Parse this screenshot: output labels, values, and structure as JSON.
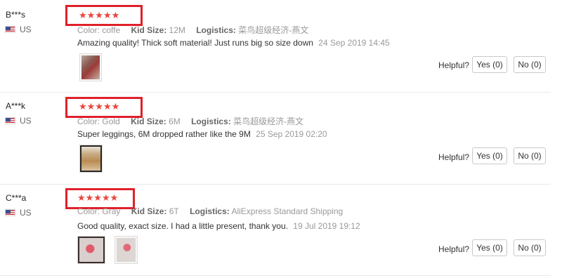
{
  "reviews": [
    {
      "name": "B***s",
      "country": "US",
      "stars": "★★★★★",
      "color_label": "Color:",
      "color_value": "coffe",
      "size_label": "Kid Size:",
      "size_value": "12M",
      "logistics_label": "Logistics:",
      "logistics_value": "菜鸟超级经济-燕文",
      "text": "Amazing quality! Thick soft material! Just runs big so size down",
      "date": "24 Sep 2019 14:45",
      "helpful_label": "Helpful?",
      "yes_label": "Yes (0)",
      "no_label": "No (0)"
    },
    {
      "name": "A***k",
      "country": "US",
      "stars": "★★★★★",
      "color_label": "Color:",
      "color_value": "Gold",
      "size_label": "Kid Size:",
      "size_value": "6M",
      "logistics_label": "Logistics:",
      "logistics_value": "菜鸟超级经济-燕文",
      "text": "Super leggings, 6M dropped rather like the 9M",
      "date": "25 Sep 2019 02:20",
      "helpful_label": "Helpful?",
      "yes_label": "Yes (0)",
      "no_label": "No (0)"
    },
    {
      "name": "C***a",
      "country": "US",
      "stars": "★★★★★",
      "color_label": "Color:",
      "color_value": "Gray",
      "size_label": "Kid Size:",
      "size_value": "6T",
      "logistics_label": "Logistics:",
      "logistics_value": "AliExpress Standard Shipping",
      "text": "Good quality, exact size. I had a little present, thank you.",
      "date": "19 Jul 2019 19:12",
      "helpful_label": "Helpful?",
      "yes_label": "Yes (0)",
      "no_label": "No (0)"
    }
  ],
  "colors": {
    "star": "#e8453c",
    "highlight_box": "#e0202a",
    "muted_text": "#999999"
  }
}
